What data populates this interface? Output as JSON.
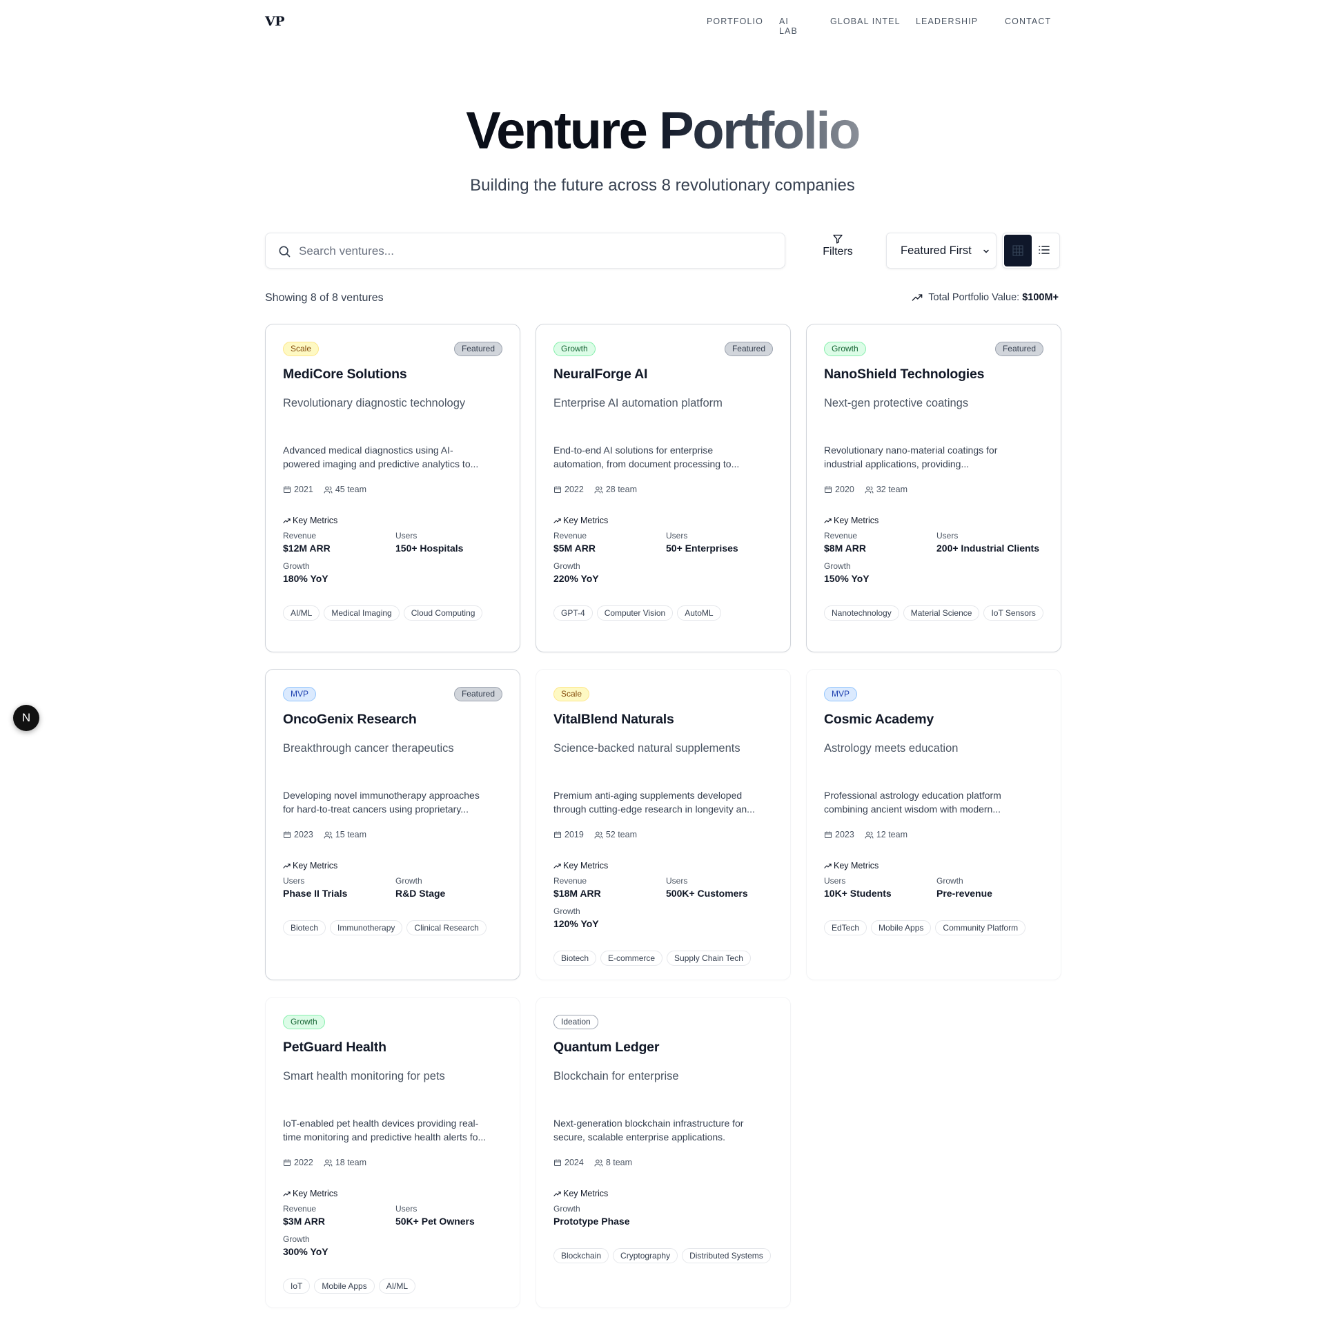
{
  "nav": {
    "logo": "VP",
    "links": [
      "PORTFOLIO",
      "AI LAB",
      "GLOBAL INTEL",
      "LEADERSHIP",
      "CONTACT"
    ]
  },
  "hero": {
    "title_part1": "Venture ",
    "title_part2": "Portfolio",
    "subtitle": "Building the future across 8 revolutionary companies"
  },
  "toolbar": {
    "search_placeholder": "Search ventures...",
    "filters_label": "Filters",
    "sort_selected": "Featured First",
    "view_mode": "grid"
  },
  "summary": {
    "showing": "Showing 8 of 8 ventures",
    "total_label": "Total Portfolio Value:",
    "total_value": "$100M+"
  },
  "colors": {
    "stage_scale": "#fef9c3",
    "stage_growth": "#dcfce7",
    "stage_mvp": "#dbeafe",
    "stage_ideation": "#ffffff",
    "primary_dark": "#0f172a"
  },
  "ventures": [
    {
      "stage": "Scale",
      "stage_class": "scale",
      "featured": "Featured",
      "name": "MediCore Solutions",
      "tagline": "Revolutionary diagnostic technology",
      "desc_line1": "Advanced medical diagnostics using AI-",
      "desc_line2": "powered imaging and predictive analytics to...",
      "year": "2021",
      "team": "45 team",
      "metrics_title": "Key Metrics",
      "metrics": [
        {
          "label": "Revenue",
          "value": "$12M ARR"
        },
        {
          "label": "Users",
          "value": "150+ Hospitals"
        },
        {
          "label": "Growth",
          "value": "180% YoY"
        }
      ],
      "tags": [
        "AI/ML",
        "Medical Imaging",
        "Cloud Computing"
      ]
    },
    {
      "stage": "Growth",
      "stage_class": "growth",
      "featured": "Featured",
      "name": "NeuralForge AI",
      "tagline": "Enterprise AI automation platform",
      "desc_line1": "End-to-end AI solutions for enterprise",
      "desc_line2": "automation, from document processing to...",
      "year": "2022",
      "team": "28 team",
      "metrics_title": "Key Metrics",
      "metrics": [
        {
          "label": "Revenue",
          "value": "$5M ARR"
        },
        {
          "label": "Users",
          "value": "50+ Enterprises"
        },
        {
          "label": "Growth",
          "value": "220% YoY"
        }
      ],
      "tags": [
        "GPT-4",
        "Computer Vision",
        "AutoML"
      ]
    },
    {
      "stage": "Growth",
      "stage_class": "growth",
      "featured": "Featured",
      "name": "NanoShield Technologies",
      "tagline": "Next-gen protective coatings",
      "desc_line1": "Revolutionary nano-material coatings for",
      "desc_line2": "industrial applications, providing...",
      "year": "2020",
      "team": "32 team",
      "metrics_title": "Key Metrics",
      "metrics": [
        {
          "label": "Revenue",
          "value": "$8M ARR"
        },
        {
          "label": "Users",
          "value": "200+ Industrial Clients"
        },
        {
          "label": "Growth",
          "value": "150% YoY"
        }
      ],
      "tags": [
        "Nanotechnology",
        "Material Science",
        "IoT Sensors"
      ]
    },
    {
      "stage": "MVP",
      "stage_class": "mvp",
      "featured": "Featured",
      "name": "OncoGenix Research",
      "tagline": "Breakthrough cancer therapeutics",
      "desc_line1": "Developing novel immunotherapy approaches",
      "desc_line2": "for hard-to-treat cancers using proprietary...",
      "year": "2023",
      "team": "15 team",
      "metrics_title": "Key Metrics",
      "metrics": [
        {
          "label": "Users",
          "value": "Phase II Trials"
        },
        {
          "label": "Growth",
          "value": "R&D Stage"
        }
      ],
      "tags": [
        "Biotech",
        "Immunotherapy",
        "Clinical Research"
      ]
    },
    {
      "stage": "Scale",
      "stage_class": "scale",
      "featured": "",
      "name": "VitalBlend Naturals",
      "tagline": "Science-backed natural supplements",
      "desc_line1": "Premium anti-aging supplements developed",
      "desc_line2": "through cutting-edge research in longevity an...",
      "year": "2019",
      "team": "52 team",
      "metrics_title": "Key Metrics",
      "metrics": [
        {
          "label": "Revenue",
          "value": "$18M ARR"
        },
        {
          "label": "Users",
          "value": "500K+ Customers"
        },
        {
          "label": "Growth",
          "value": "120% YoY"
        }
      ],
      "tags": [
        "Biotech",
        "E-commerce",
        "Supply Chain Tech"
      ]
    },
    {
      "stage": "MVP",
      "stage_class": "mvp",
      "featured": "",
      "name": "Cosmic Academy",
      "tagline": "Astrology meets education",
      "desc_line1": "Professional astrology education platform",
      "desc_line2": "combining ancient wisdom with modern...",
      "year": "2023",
      "team": "12 team",
      "metrics_title": "Key Metrics",
      "metrics": [
        {
          "label": "Users",
          "value": "10K+ Students"
        },
        {
          "label": "Growth",
          "value": "Pre-revenue"
        }
      ],
      "tags": [
        "EdTech",
        "Mobile Apps",
        "Community Platform"
      ]
    },
    {
      "stage": "Growth",
      "stage_class": "growth",
      "featured": "",
      "name": "PetGuard Health",
      "tagline": "Smart health monitoring for pets",
      "desc_line1": "IoT-enabled pet health devices providing real-",
      "desc_line2": "time monitoring and predictive health alerts fo...",
      "year": "2022",
      "team": "18 team",
      "metrics_title": "Key Metrics",
      "metrics": [
        {
          "label": "Revenue",
          "value": "$3M ARR"
        },
        {
          "label": "Users",
          "value": "50K+ Pet Owners"
        },
        {
          "label": "Growth",
          "value": "300% YoY"
        }
      ],
      "tags": [
        "IoT",
        "Mobile Apps",
        "AI/ML"
      ]
    },
    {
      "stage": "Ideation",
      "stage_class": "ideation",
      "featured": "",
      "name": "Quantum Ledger",
      "tagline": "Blockchain for enterprise",
      "desc_line1": "Next-generation blockchain infrastructure for",
      "desc_line2": "secure, scalable enterprise applications.",
      "year": "2024",
      "team": "8 team",
      "metrics_title": "Key Metrics",
      "metrics": [
        {
          "label": "Growth",
          "value": "Prototype Phase"
        }
      ],
      "tags": [
        "Blockchain",
        "Cryptography",
        "Distributed Systems"
      ]
    }
  ],
  "floating_button": {
    "label": "N",
    "icon": "nextjs-icon"
  }
}
